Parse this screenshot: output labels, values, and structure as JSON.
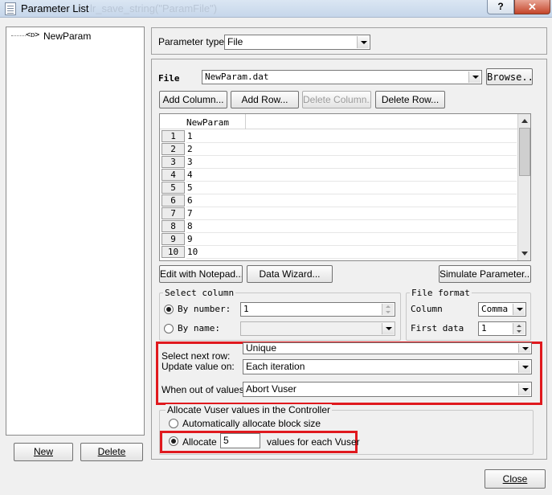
{
  "window": {
    "title": "Parameter List",
    "ghost_title": "lr_save_string(\"ParamFile\")",
    "help_label": "?",
    "close_label": "✕"
  },
  "tree": {
    "node_icon": "<ᴅ>",
    "node_label": "NewParam"
  },
  "left_buttons": {
    "new": "New",
    "delete": "Delete"
  },
  "param_type": {
    "label": "Parameter type:",
    "value": "File"
  },
  "file": {
    "label": "File",
    "value": "NewParam.dat",
    "browse": "Browse..."
  },
  "toolbar": {
    "add_column": "Add Column...",
    "add_row": "Add Row...",
    "delete_column": "Delete Column...",
    "delete_row": "Delete Row..."
  },
  "table": {
    "column": "NewParam",
    "rows": [
      {
        "n": "1",
        "v": "1"
      },
      {
        "n": "2",
        "v": "2"
      },
      {
        "n": "3",
        "v": "3"
      },
      {
        "n": "4",
        "v": "4"
      },
      {
        "n": "5",
        "v": "5"
      },
      {
        "n": "6",
        "v": "6"
      },
      {
        "n": "7",
        "v": "7"
      },
      {
        "n": "8",
        "v": "8"
      },
      {
        "n": "9",
        "v": "9"
      },
      {
        "n": "10",
        "v": "10"
      }
    ]
  },
  "actions": {
    "edit_notepad": "Edit with Notepad...",
    "data_wizard": "Data Wizard...",
    "simulate": "Simulate Parameter..."
  },
  "select_column": {
    "title": "Select column",
    "by_number": "By number:",
    "by_number_value": "1",
    "by_name": "By name:",
    "by_name_value": ""
  },
  "file_format": {
    "title": "File format",
    "column_label": "Column",
    "column_value": "Comma",
    "first_data_label": "First data",
    "first_data_value": "1"
  },
  "row_options": {
    "select_next_row_label": "Select next row:",
    "select_next_row_value": "Unique",
    "update_value_label": "Update value on:",
    "update_value_value": "Each iteration",
    "out_of_values_label": "When out of values:",
    "out_of_values_value": "Abort Vuser"
  },
  "allocate": {
    "title": "Allocate Vuser values in the Controller",
    "auto_label": "Automatically allocate block size",
    "allocate_label": "Allocate",
    "allocate_value": "5",
    "allocate_suffix": "values for each Vuser"
  },
  "footer": {
    "close": "Close"
  },
  "colors": {
    "highlight": "#e0191e"
  }
}
